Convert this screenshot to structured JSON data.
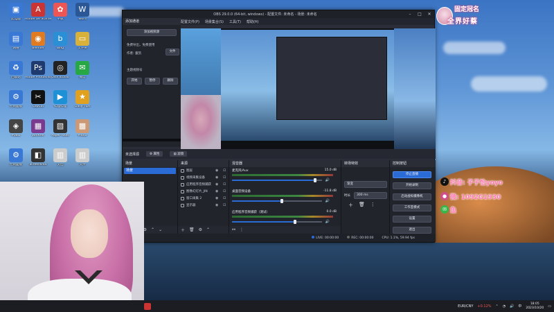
{
  "desktop": {
    "icons": [
      {
        "label": "此电脑",
        "color": "#3a78d6",
        "glyph": "▣"
      },
      {
        "label": "Adobe Ge Starter",
        "color": "#c33",
        "glyph": "A"
      },
      {
        "label": "千帆",
        "color": "#e55",
        "glyph": "✿"
      },
      {
        "label": "Word",
        "color": "#2b5797",
        "glyph": "W"
      },
      {
        "label": "网络",
        "color": "#3a78d6",
        "glyph": "▤"
      },
      {
        "label": "Blender",
        "color": "#e07b22",
        "glyph": "◉"
      },
      {
        "label": "Bing",
        "color": "#2b8fd6",
        "glyph": "b"
      },
      {
        "label": "文件夹",
        "color": "#d8b13b",
        "glyph": "▭"
      },
      {
        "label": "回收站",
        "color": "#3a78d6",
        "glyph": "♻"
      },
      {
        "label": "Adobe Photoshop",
        "color": "#1e3a6e",
        "glyph": "Ps"
      },
      {
        "label": "OBS Studio",
        "color": "#222",
        "glyph": "◎"
      },
      {
        "label": "微信",
        "color": "#28a745",
        "glyph": "✉"
      },
      {
        "label": "控制面板",
        "color": "#3a78d6",
        "glyph": "⚙"
      },
      {
        "label": "CapCut",
        "color": "#111",
        "glyph": "✂"
      },
      {
        "label": "哔哩哔哩",
        "color": "#1e90d6",
        "glyph": "▶"
      },
      {
        "label": "Daily Tips",
        "color": "#e0a020",
        "glyph": "★"
      },
      {
        "label": "PUBG",
        "color": "#444",
        "glyph": "◈"
      },
      {
        "label": "WinRAR",
        "color": "#7a3b8f",
        "glyph": "▦"
      },
      {
        "label": "Paper Tools",
        "color": "#333",
        "glyph": "▧"
      },
      {
        "label": "Photo",
        "color": "#c97",
        "glyph": "▩"
      },
      {
        "label": "控制面板",
        "color": "#3a78d6",
        "glyph": "⚙"
      },
      {
        "label": "Screenshot",
        "color": "#333",
        "glyph": "◧"
      },
      {
        "label": "文档",
        "color": "#ccc",
        "glyph": "▥"
      },
      {
        "label": "文件",
        "color": "#ccc",
        "glyph": "▥"
      }
    ]
  },
  "obs": {
    "title": "OBS 29.0.0 (64-bit, windows) - 配置文件: 未命名 - 场景: 未命名",
    "menu": [
      "配置文件(P)",
      "场景集合(S)",
      "工具(T)",
      "帮助(H)"
    ],
    "left_panel": {
      "header": "添加通道",
      "btn_top": "添加视频源",
      "text1": "免费导出，免费使用",
      "text2": "作者: 童凯",
      "text3": "主题视频号",
      "btn1": "开始",
      "btn2": "暂停",
      "btn3": "删除",
      "btn_side": "文件"
    },
    "scene_bar": {
      "label": "未选择源",
      "props": "属性",
      "filters": "滤镜"
    },
    "scenes": {
      "header": "场景",
      "items": [
        "场景"
      ]
    },
    "sources": {
      "header": "来源",
      "items": [
        "图层",
        "视频采集设备",
        "应用程序音频捕获",
        "图像幻灯片_JIN",
        "窗口采集 2",
        "显示器"
      ]
    },
    "mixer": {
      "header": "混音器",
      "channels": [
        {
          "name": "麦克风/Aux",
          "db": "15.0 dB",
          "level": 0.92
        },
        {
          "name": "桌面音频设备",
          "db": "-11.8 dB",
          "level": 0.55
        },
        {
          "name": "应用程序音频捕获（测试）",
          "db": "0.0 dB",
          "level": 0.7
        }
      ]
    },
    "transitions": {
      "header": "转场特效",
      "selected": "渐变",
      "duration_label": "时长",
      "duration": "300 ms"
    },
    "controls": {
      "header": "控制按钮",
      "buttons": [
        "停止直播",
        "开始录制",
        "启动虚拟摄像机",
        "工作室模式",
        "设置",
        "退出"
      ]
    },
    "status": {
      "live": "LIVE: 00:00:00",
      "rec": "REC: 00:00:00",
      "cpu": "CPU: 1.1%, 59.94 fps"
    }
  },
  "overlay": {
    "title": "固定冠名",
    "subtitle": "全界好蔡",
    "line1": "抖音: 子子怡yoyo",
    "line2": "微: 1092G1930",
    "line3": "鱼"
  },
  "taskbar": {
    "fx_pair": "EUR/CNY",
    "fx_change": "+0.12%",
    "time": "18:05",
    "date": "2023/10/20"
  },
  "colors": {
    "accent": "#2b6bd6",
    "brand_pink": "#ff7ab3"
  }
}
